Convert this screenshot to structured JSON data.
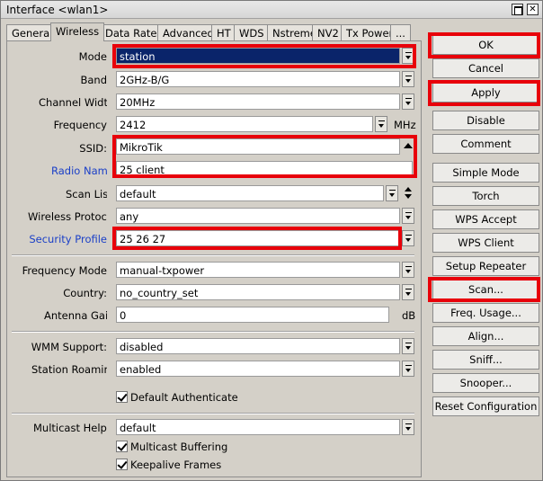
{
  "window": {
    "title": "Interface <wlan1>"
  },
  "tabs": [
    "General",
    "Wireless",
    "Data Rates",
    "Advanced",
    "HT",
    "WDS",
    "Nstreme",
    "NV2",
    "Tx Power",
    "..."
  ],
  "fields": {
    "mode": {
      "label": "Mode",
      "value": "station"
    },
    "band": {
      "label": "Band",
      "value": "2GHz-B/G"
    },
    "channel_width": {
      "label": "Channel Widt",
      "value": "20MHz"
    },
    "frequency": {
      "label": "Frequency",
      "value": "2412",
      "unit": "MHz"
    },
    "ssid": {
      "label": "SSID:",
      "value": "MikroTik"
    },
    "radio_name": {
      "label": "Radio Name",
      "value": "25 client"
    },
    "scan_list": {
      "label": "Scan List",
      "value": "default"
    },
    "wireless_protocol": {
      "label": "Wireless Protoco",
      "value": "any"
    },
    "security_profile": {
      "label": "Security Profile",
      "value": "25 26 27"
    },
    "frequency_mode": {
      "label": "Frequency Mode",
      "value": "manual-txpower"
    },
    "country": {
      "label": "Country:",
      "value": "no_country_set"
    },
    "antenna_gain": {
      "label": "Antenna Gai",
      "value": "0",
      "unit": "dB"
    },
    "wmm_support": {
      "label": "WMM Support:",
      "value": "disabled"
    },
    "station_roaming": {
      "label": "Station Roaming",
      "value": "enabled"
    },
    "multicast_helper": {
      "label": "Multicast Helpe",
      "value": "default"
    }
  },
  "checkboxes": {
    "default_authenticate": "Default Authenticate",
    "multicast_buffering": "Multicast Buffering",
    "keepalive_frames": "Keepalive Frames"
  },
  "buttons": [
    "OK",
    "Cancel",
    "Apply",
    "Disable",
    "Comment",
    "Simple Mode",
    "Torch",
    "WPS Accept",
    "WPS Client",
    "Setup Repeater",
    "Scan...",
    "Freq. Usage...",
    "Align...",
    "Sniff...",
    "Snooper...",
    "Reset Configuration"
  ],
  "colors": {
    "highlight": "#e8000a",
    "selection": "#0a246a",
    "link_label": "#1a3fc7"
  }
}
